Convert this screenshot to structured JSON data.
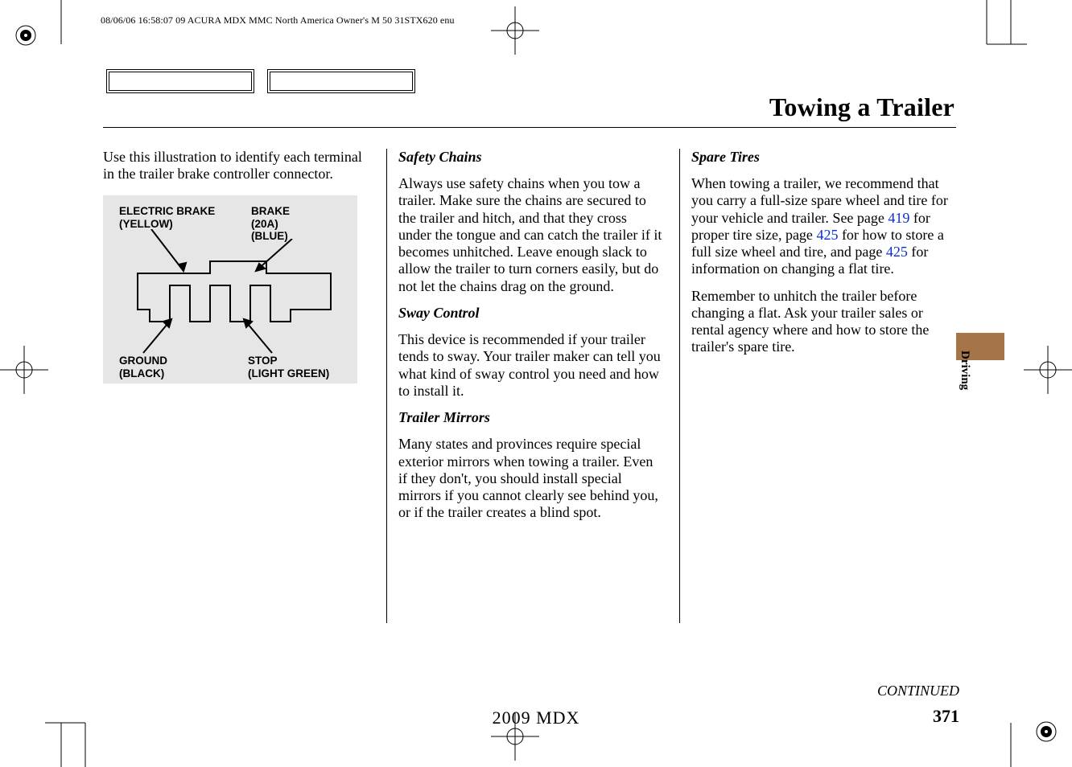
{
  "header_line": "08/06/06 16:58:07   09 ACURA MDX MMC North America Owner's M 50 31STX620 enu",
  "section_title": "Towing a Trailer",
  "col1": {
    "intro": "Use this illustration to identify each terminal in the trailer brake controller connector.",
    "diagram_labels": {
      "electric_brake": "ELECTRIC BRAKE\n(YELLOW)",
      "brake_20a": "BRAKE\n(20A)\n(BLUE)",
      "ground": "GROUND\n(BLACK)",
      "stop": "STOP\n(LIGHT GREEN)"
    }
  },
  "col2": {
    "safety_chains_head": "Safety Chains",
    "safety_chains_body": "Always use safety chains when you tow a trailer. Make sure the chains are secured to the trailer and hitch, and that they cross under the tongue and can catch the trailer if it becomes unhitched. Leave enough slack to allow the trailer to turn corners easily, but do not let the chains drag on the ground.",
    "sway_head": "Sway Control",
    "sway_body": "This device is recommended if your trailer tends to sway. Your trailer maker can tell you what kind of sway control you need and how to install it.",
    "mirrors_head": "Trailer Mirrors",
    "mirrors_body": "Many states and provinces require special exterior mirrors when towing a trailer. Even if they don't, you should install special mirrors if you cannot clearly see behind you, or if the trailer creates a blind spot."
  },
  "col3": {
    "spare_head": "Spare Tires",
    "spare_p1_a": "When towing a trailer, we recommend that you carry a full-size spare wheel and tire for your vehicle and trailer. See page ",
    "link_419": "419",
    "spare_p1_b": " for proper tire size, page ",
    "link_425a": "425",
    "spare_p1_c": " for how to store a full size wheel and tire, and page ",
    "link_425b": "425",
    "spare_p1_d": " for information on changing a flat tire.",
    "spare_p2": "Remember to unhitch the trailer before changing a flat. Ask your trailer sales or rental agency where and how to store the trailer's spare tire."
  },
  "tab_text": "Driving",
  "continued": "CONTINUED",
  "page_number": "371",
  "foot_model": "2009  MDX"
}
